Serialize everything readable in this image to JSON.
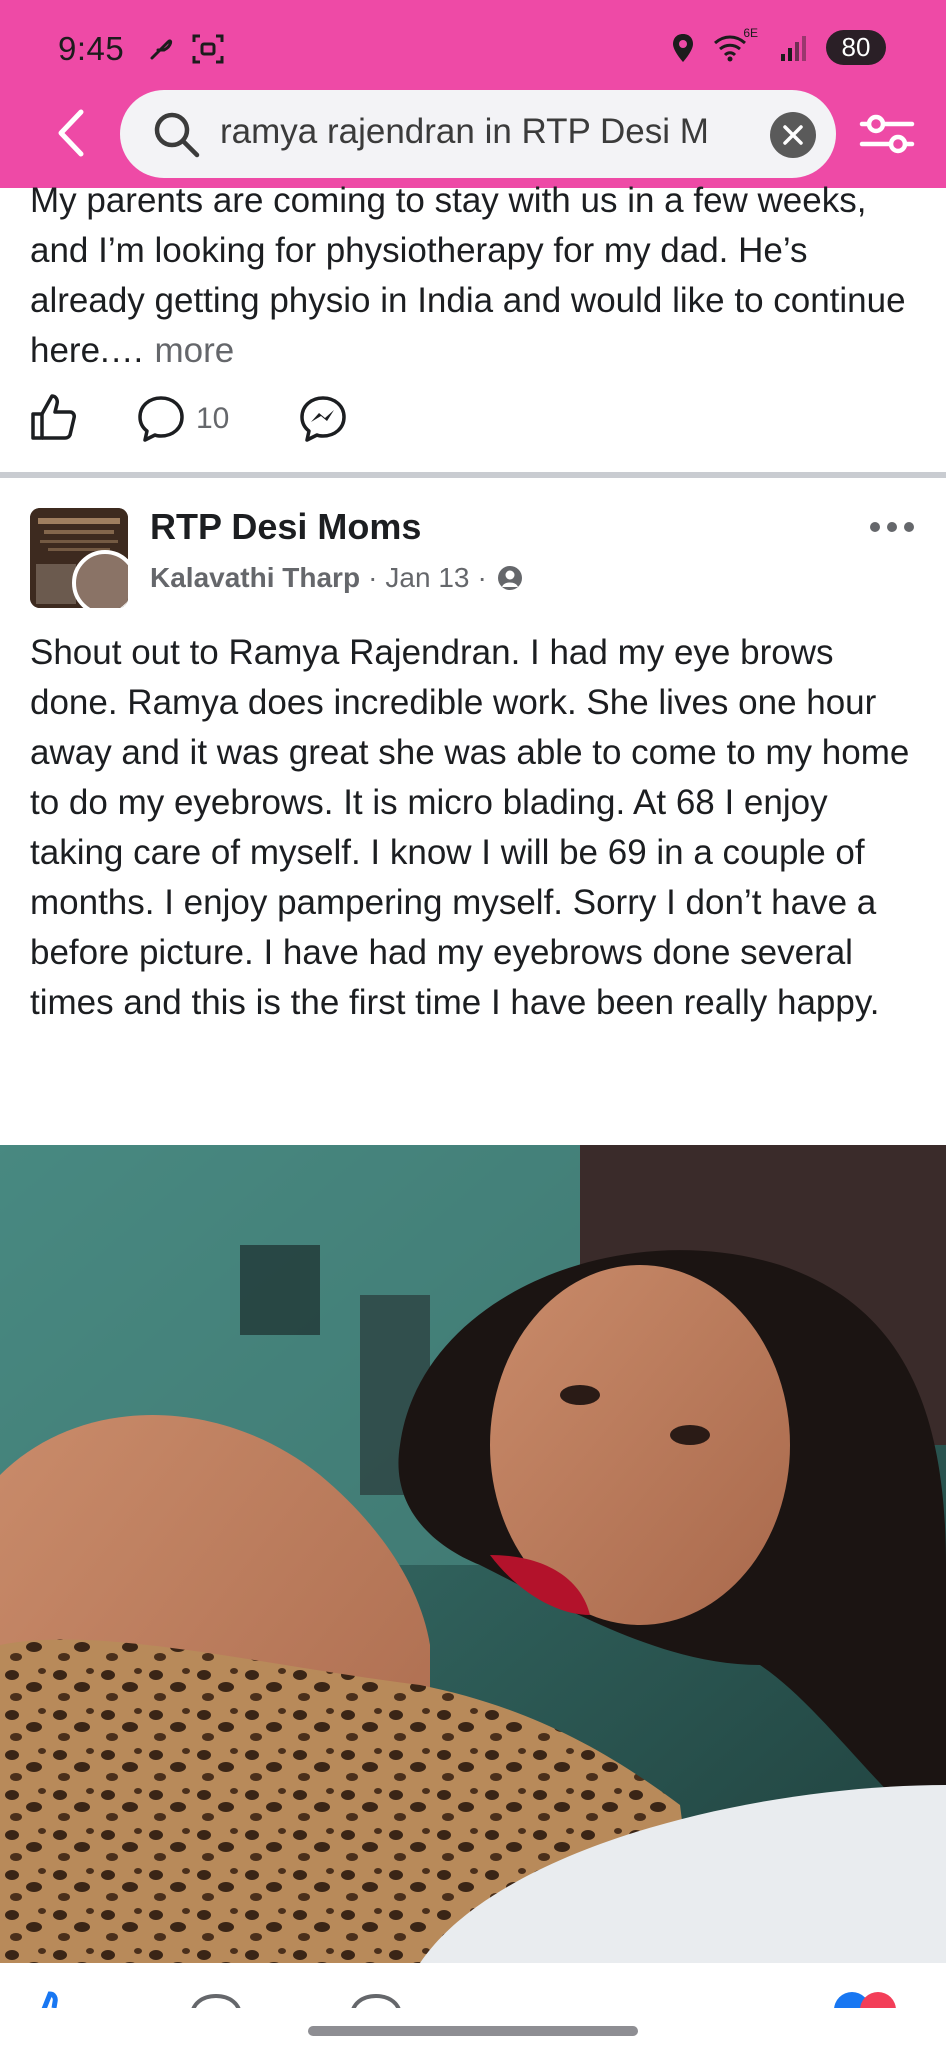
{
  "status_bar": {
    "time": "9:45",
    "network_label": "6E",
    "battery": "80"
  },
  "search": {
    "query": "ramya rajendran in RTP Desi M"
  },
  "post1": {
    "text": "My parents are coming to stay with us in a few weeks, and I’m looking for physiotherapy for my dad. He’s already getting physio in India and would like to continue here.…",
    "more_label": "more",
    "comment_count": "10"
  },
  "post2": {
    "group_name": "RTP Desi Moms",
    "author": "Kalavathi Tharp",
    "date": "Jan 13",
    "separator": "·",
    "text": "Shout out to Ramya Rajendran.  I had my eye brows done.  Ramya does incredible work.  She lives one hour away and it was great she was able to come to my home to do my eyebrows.  It is micro blading.  At 68 I enjoy taking care of myself.  I know I will be 69 in a couple of months.  I enjoy pampering myself.  Sorry I don’t have a before picture.  I have had my eyebrows done several times and this is the first time I have been really happy."
  },
  "colors": {
    "header_bg": "#ee4aa6",
    "text_primary": "#1c1e21",
    "text_secondary": "#65676b",
    "divider": "#c9ccd1"
  },
  "icons": [
    "back-arrow-icon",
    "search-icon",
    "clear-icon",
    "filter-icon",
    "like-icon",
    "comment-icon",
    "messenger-icon",
    "more-options-icon",
    "privacy-icon"
  ]
}
